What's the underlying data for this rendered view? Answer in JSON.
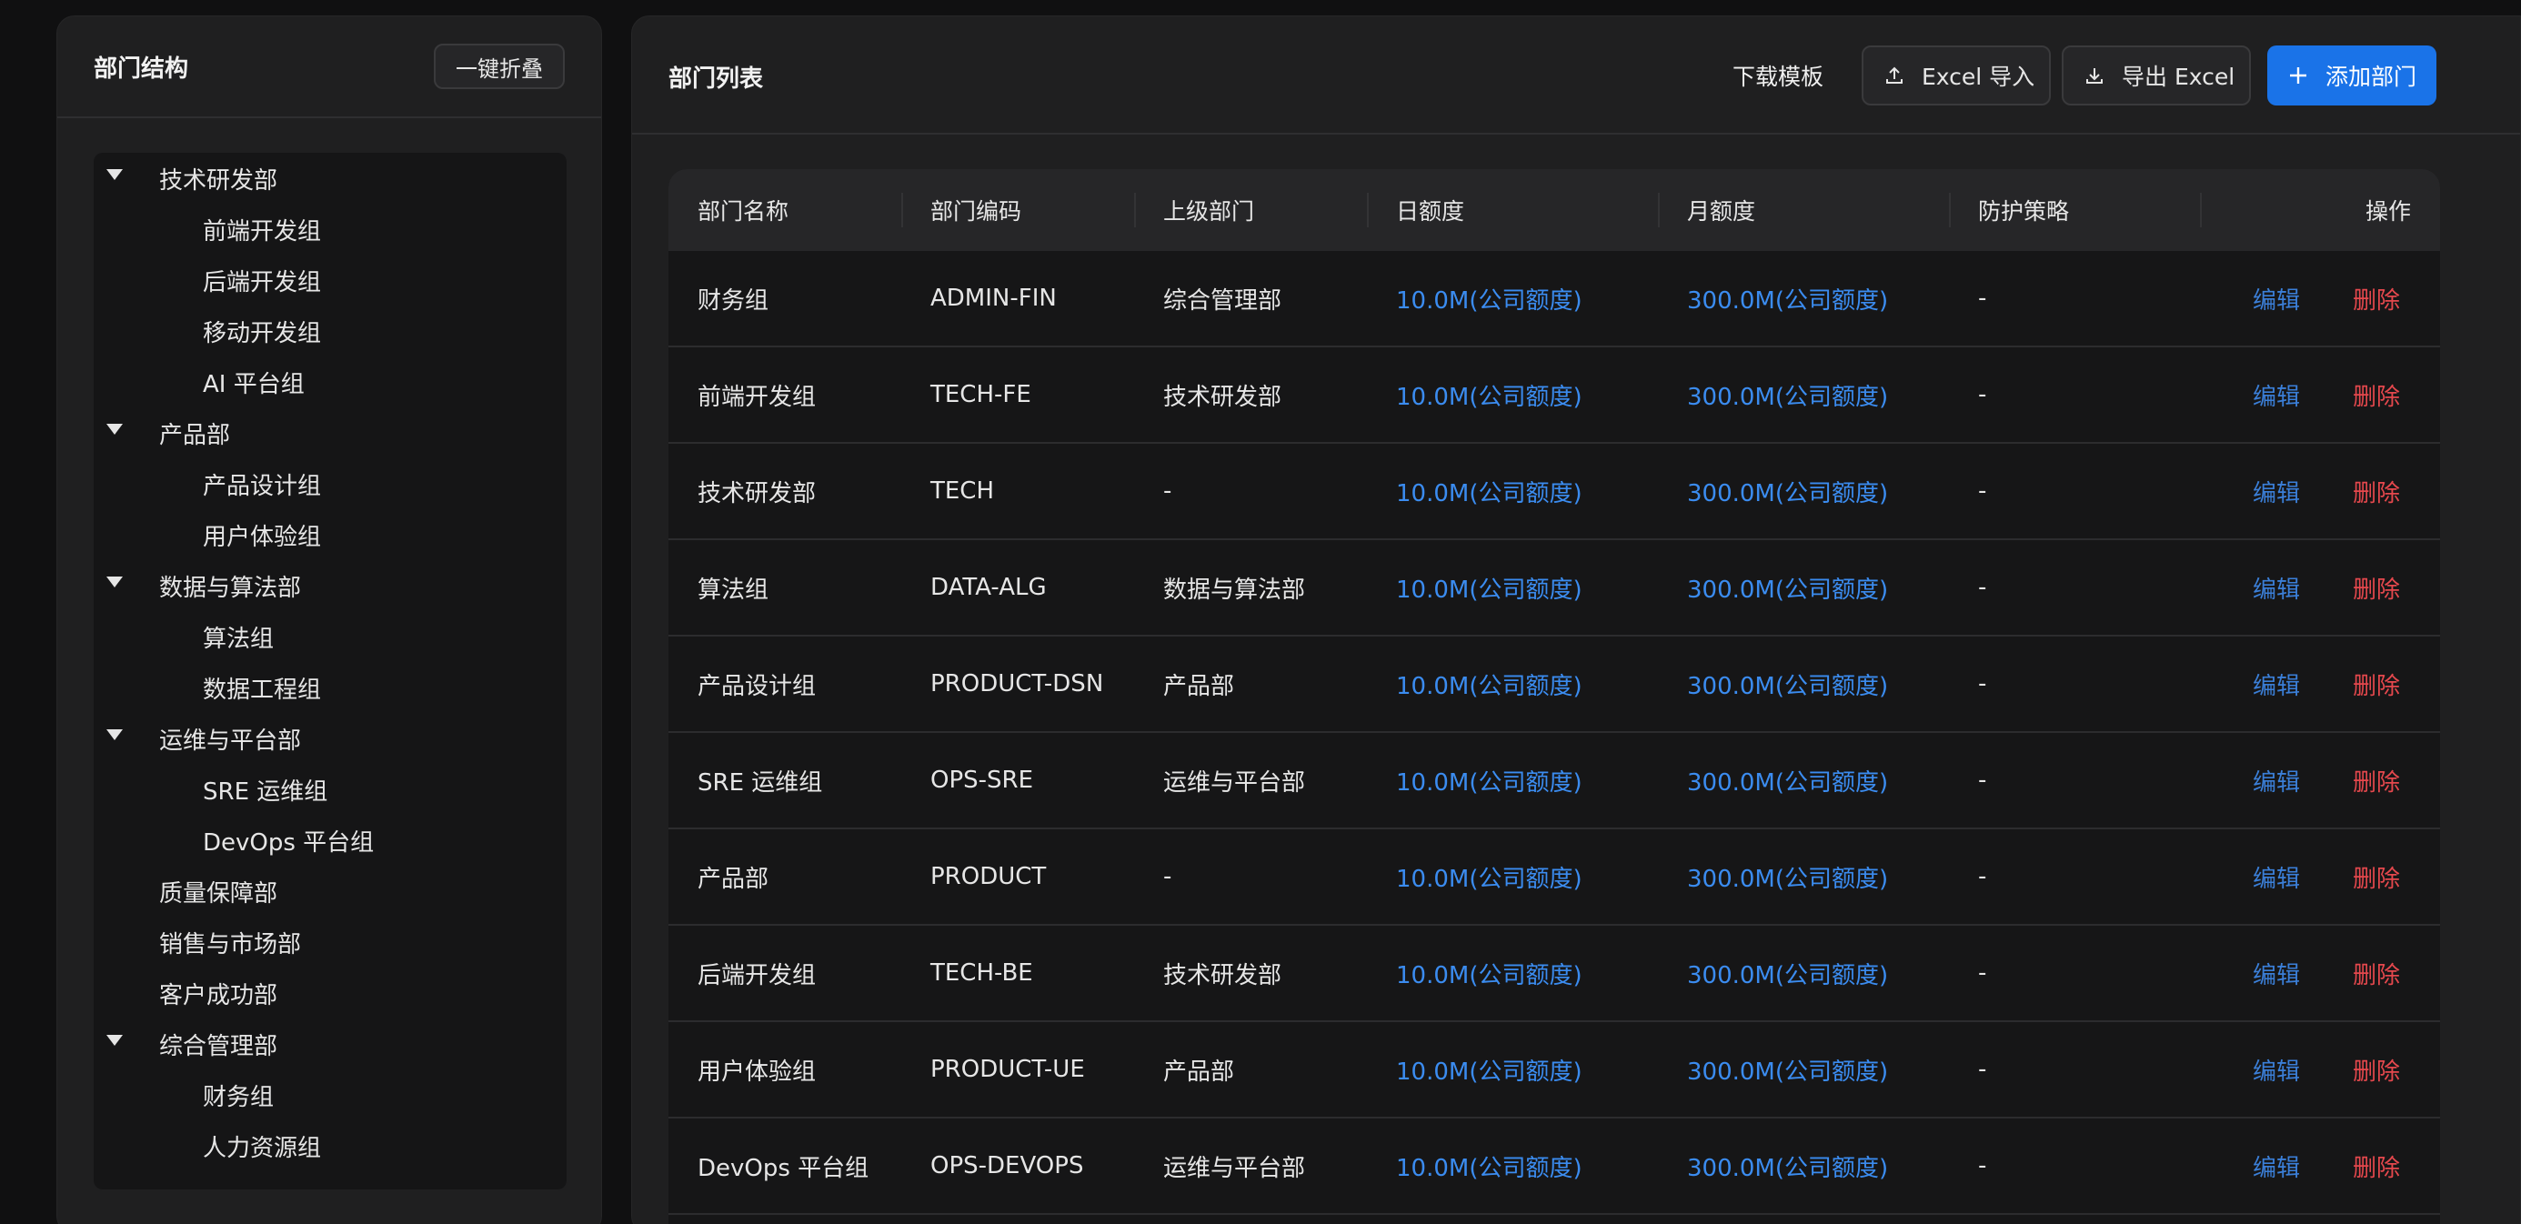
{
  "sidebar": {
    "title": "部门结构",
    "collapse_label": "一键折叠",
    "tree": [
      {
        "label": "技术研发部",
        "level": 0,
        "expanded": true
      },
      {
        "label": "前端开发组",
        "level": 1
      },
      {
        "label": "后端开发组",
        "level": 1
      },
      {
        "label": "移动开发组",
        "level": 1
      },
      {
        "label": "AI 平台组",
        "level": 1
      },
      {
        "label": "产品部",
        "level": 0,
        "expanded": true
      },
      {
        "label": "产品设计组",
        "level": 1
      },
      {
        "label": "用户体验组",
        "level": 1
      },
      {
        "label": "数据与算法部",
        "level": 0,
        "expanded": true
      },
      {
        "label": "算法组",
        "level": 1
      },
      {
        "label": "数据工程组",
        "level": 1
      },
      {
        "label": "运维与平台部",
        "level": 0,
        "expanded": true
      },
      {
        "label": "SRE 运维组",
        "level": 1
      },
      {
        "label": "DevOps 平台组",
        "level": 1
      },
      {
        "label": "质量保障部",
        "level": 0,
        "expanded": false
      },
      {
        "label": "销售与市场部",
        "level": 0,
        "expanded": false
      },
      {
        "label": "客户成功部",
        "level": 0,
        "expanded": false
      },
      {
        "label": "综合管理部",
        "level": 0,
        "expanded": true
      },
      {
        "label": "财务组",
        "level": 1
      },
      {
        "label": "人力资源组",
        "level": 1
      }
    ]
  },
  "main": {
    "title": "部门列表",
    "actions": {
      "download_template": "下载模板",
      "excel_import": "Excel 导入",
      "export_excel": "导出 Excel",
      "add_department": "添加部门"
    },
    "table": {
      "columns": [
        "部门名称",
        "部门编码",
        "上级部门",
        "日额度",
        "月额度",
        "防护策略",
        "操作"
      ],
      "edit_label": "编辑",
      "delete_label": "删除",
      "rows": [
        {
          "name": "财务组",
          "code": "ADMIN-FIN",
          "parent": "综合管理部",
          "daily": "10.0M(公司额度)",
          "monthly": "300.0M(公司额度)",
          "policy": "-"
        },
        {
          "name": "前端开发组",
          "code": "TECH-FE",
          "parent": "技术研发部",
          "daily": "10.0M(公司额度)",
          "monthly": "300.0M(公司额度)",
          "policy": "-"
        },
        {
          "name": "技术研发部",
          "code": "TECH",
          "parent": "-",
          "daily": "10.0M(公司额度)",
          "monthly": "300.0M(公司额度)",
          "policy": "-"
        },
        {
          "name": "算法组",
          "code": "DATA-ALG",
          "parent": "数据与算法部",
          "daily": "10.0M(公司额度)",
          "monthly": "300.0M(公司额度)",
          "policy": "-"
        },
        {
          "name": "产品设计组",
          "code": "PRODUCT-DSN",
          "parent": "产品部",
          "daily": "10.0M(公司额度)",
          "monthly": "300.0M(公司额度)",
          "policy": "-"
        },
        {
          "name": "SRE 运维组",
          "code": "OPS-SRE",
          "parent": "运维与平台部",
          "daily": "10.0M(公司额度)",
          "monthly": "300.0M(公司额度)",
          "policy": "-"
        },
        {
          "name": "产品部",
          "code": "PRODUCT",
          "parent": "-",
          "daily": "10.0M(公司额度)",
          "monthly": "300.0M(公司额度)",
          "policy": "-"
        },
        {
          "name": "后端开发组",
          "code": "TECH-BE",
          "parent": "技术研发部",
          "daily": "10.0M(公司额度)",
          "monthly": "300.0M(公司额度)",
          "policy": "-"
        },
        {
          "name": "用户体验组",
          "code": "PRODUCT-UE",
          "parent": "产品部",
          "daily": "10.0M(公司额度)",
          "monthly": "300.0M(公司额度)",
          "policy": "-"
        },
        {
          "name": "DevOps 平台组",
          "code": "OPS-DEVOPS",
          "parent": "运维与平台部",
          "daily": "10.0M(公司额度)",
          "monthly": "300.0M(公司额度)",
          "policy": "-"
        }
      ]
    }
  }
}
